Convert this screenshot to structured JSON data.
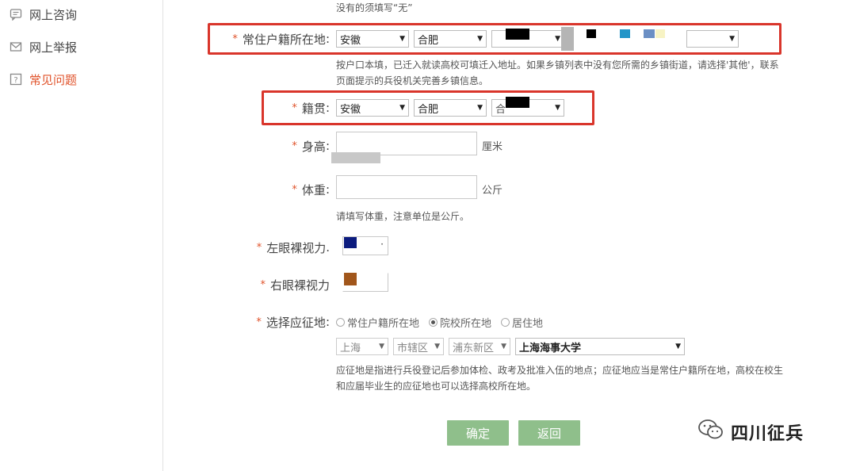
{
  "sidebar": {
    "items": [
      {
        "label": "网上咨询",
        "icon": "chat-icon"
      },
      {
        "label": "网上举报",
        "icon": "mail-icon"
      },
      {
        "label": "常见问题",
        "icon": "question-icon",
        "active": true
      }
    ]
  },
  "form": {
    "top_hint": "没有的须填写“无”",
    "residence": {
      "label": "常住户籍所在地",
      "colon": ":",
      "province": "安徽",
      "city": "合肥",
      "hint_line1": "按户口本填，已迁入就读高校可填迁入地址。如果乡镇列表中没有您所需的乡镇街道，请选择'其他'，联系",
      "hint_line2": "页面提示的兵役机关完善乡镇信息。"
    },
    "native_place": {
      "label": "籍贯",
      "colon": ":",
      "province": "安徽",
      "city": "合肥",
      "district_prefix": "合"
    },
    "height": {
      "label": "身高",
      "colon": ":",
      "unit": "厘米"
    },
    "weight": {
      "label": "体重",
      "colon": ":",
      "unit": "公斤",
      "hint": "请填写体重，注意单位是公斤。"
    },
    "left_eye": {
      "label": "左眼裸视力",
      "colon": ".",
      "value": "·"
    },
    "right_eye": {
      "label": "右眼裸视力",
      "colon": ""
    },
    "enlist_place": {
      "label": "选择应征地",
      "colon": ":",
      "options": [
        "常住户籍所在地",
        "院校所在地",
        "居住地"
      ],
      "selected_index": 1,
      "province": "上海",
      "district": "市辖区",
      "county": "浦东新区",
      "school": "上海海事大学",
      "hint_line1": "应征地是指进行兵役登记后参加体检、政考及批准入伍的地点；应征地应当是常住户籍所在地，高校在校生",
      "hint_line2": "和应届毕业生的应征地也可以选择高校所在地。"
    },
    "confirm_label": "确定",
    "back_label": "返回"
  },
  "watermark": {
    "text": "四川征兵",
    "icon": "wechat-icon"
  },
  "colors": {
    "accent": "#e0532b",
    "highlight": "#d9352b",
    "button": "#8fbf8b"
  }
}
